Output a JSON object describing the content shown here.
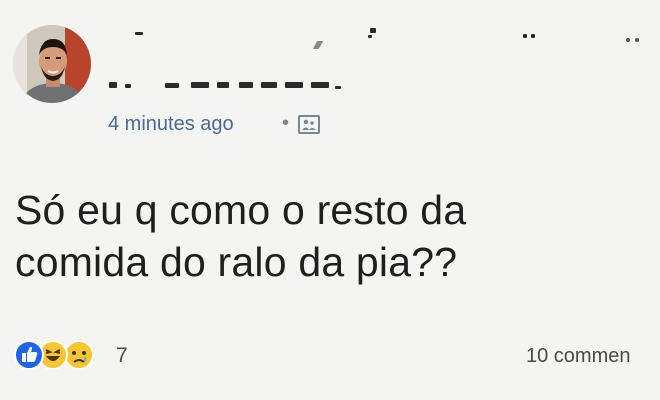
{
  "post": {
    "timestamp": "4 minutes ago",
    "separator": "•",
    "text_lines": [
      "Só eu q como o resto da",
      "comida do ralo da pia??"
    ],
    "reactions": {
      "types": [
        "like-icon",
        "haha-icon",
        "sad-icon"
      ],
      "count": "7"
    },
    "comments_count": "10 commen"
  },
  "colors": {
    "background": "#f4f5f3",
    "timestamp": "#4b6a93",
    "text": "#1f1f1f",
    "like_blue": "#1e63e9",
    "emoji_yellow": "#f7c631"
  }
}
